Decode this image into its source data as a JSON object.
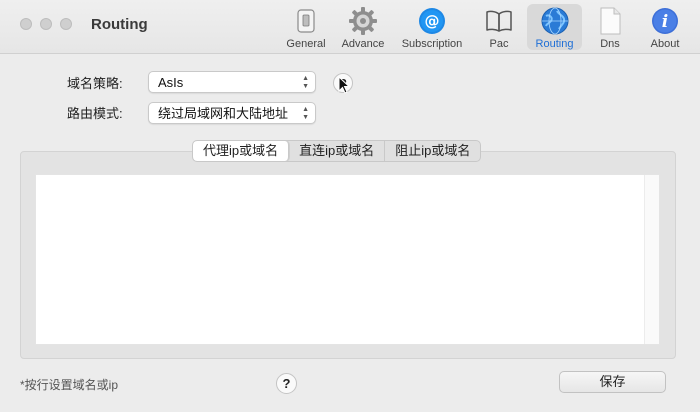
{
  "window": {
    "title": "Routing"
  },
  "toolbar": {
    "items": [
      {
        "label": "General",
        "icon": "switch-icon"
      },
      {
        "label": "Advance",
        "icon": "gear-icon"
      },
      {
        "label": "Subscription",
        "icon": "at-icon"
      },
      {
        "label": "Pac",
        "icon": "book-icon"
      },
      {
        "label": "Routing",
        "icon": "globe-icon",
        "active": true
      },
      {
        "label": "Dns",
        "icon": "document-icon"
      },
      {
        "label": "About",
        "icon": "info-icon"
      }
    ]
  },
  "form": {
    "domain_strategy_label": "域名策略:",
    "domain_strategy_value": "AsIs",
    "routing_mode_label": "路由模式:",
    "routing_mode_value": "绕过局域网和大陆地址",
    "info_button_text": "?"
  },
  "tabs": [
    {
      "label": "代理ip或域名",
      "active": true
    },
    {
      "label": "直连ip或域名"
    },
    {
      "label": "阻止ip或域名"
    }
  ],
  "editor": {
    "content": ""
  },
  "footer": {
    "hint": "*按行设置域名或ip",
    "help_text": "?",
    "save_label": "保存"
  },
  "colors": {
    "accent": "#1f6fd6",
    "window_bg": "#ececec"
  }
}
